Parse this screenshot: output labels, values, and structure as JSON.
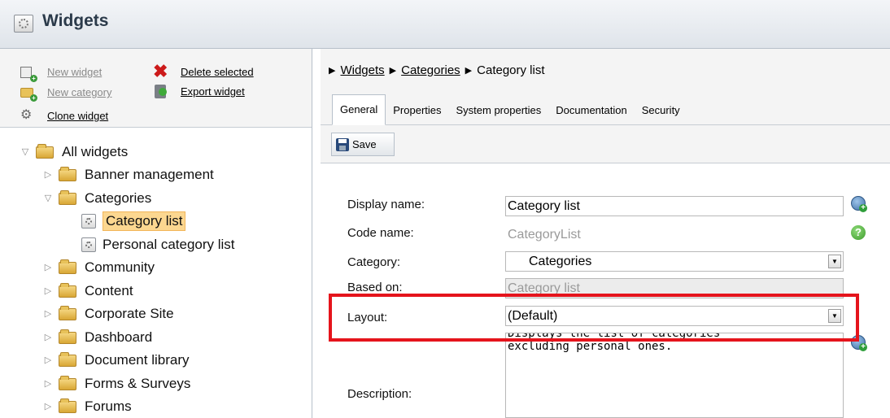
{
  "window": {
    "title": "Widgets",
    "icon": "widget-gear-icon"
  },
  "left_actions": {
    "new_widget": "New widget",
    "new_category": "New category",
    "clone_widget": "Clone widget",
    "delete_selected": "Delete selected",
    "export_widget": "Export widget"
  },
  "tree": {
    "root": "All widgets",
    "items": [
      {
        "label": "Banner management",
        "type": "folder",
        "expanded": false
      },
      {
        "label": "Categories",
        "type": "folder",
        "expanded": true
      },
      {
        "label": "Category list",
        "type": "widget",
        "selected": true
      },
      {
        "label": "Personal category list",
        "type": "widget"
      },
      {
        "label": "Community",
        "type": "folder",
        "expanded": false
      },
      {
        "label": "Content",
        "type": "folder",
        "expanded": false
      },
      {
        "label": "Corporate Site",
        "type": "folder",
        "expanded": false
      },
      {
        "label": "Dashboard",
        "type": "folder",
        "expanded": false
      },
      {
        "label": "Document library",
        "type": "folder",
        "expanded": false
      },
      {
        "label": "Forms & Surveys",
        "type": "folder",
        "expanded": false
      },
      {
        "label": "Forums",
        "type": "folder",
        "expanded": false
      }
    ]
  },
  "breadcrumb": {
    "items": [
      "Widgets",
      "Categories",
      "Category list"
    ]
  },
  "tabs": [
    "General",
    "Properties",
    "System properties",
    "Documentation",
    "Security"
  ],
  "active_tab": "General",
  "toolbar": {
    "save_label": "Save"
  },
  "form": {
    "display_name": {
      "label": "Display name:",
      "value": "Category list"
    },
    "code_name": {
      "label": "Code name:",
      "value": "CategoryList"
    },
    "category": {
      "label": "Category:",
      "value": "Categories"
    },
    "based_on": {
      "label": "Based on:",
      "value": "Category list"
    },
    "layout": {
      "label": "Layout:",
      "value": "(Default)"
    },
    "description": {
      "label": "Description:",
      "line1": "Displays the list of categories",
      "line2": "excluding personal ones."
    }
  },
  "colors": {
    "highlight": "#e5141c",
    "selection": "#fcd790",
    "title": "#2b3a4a"
  }
}
